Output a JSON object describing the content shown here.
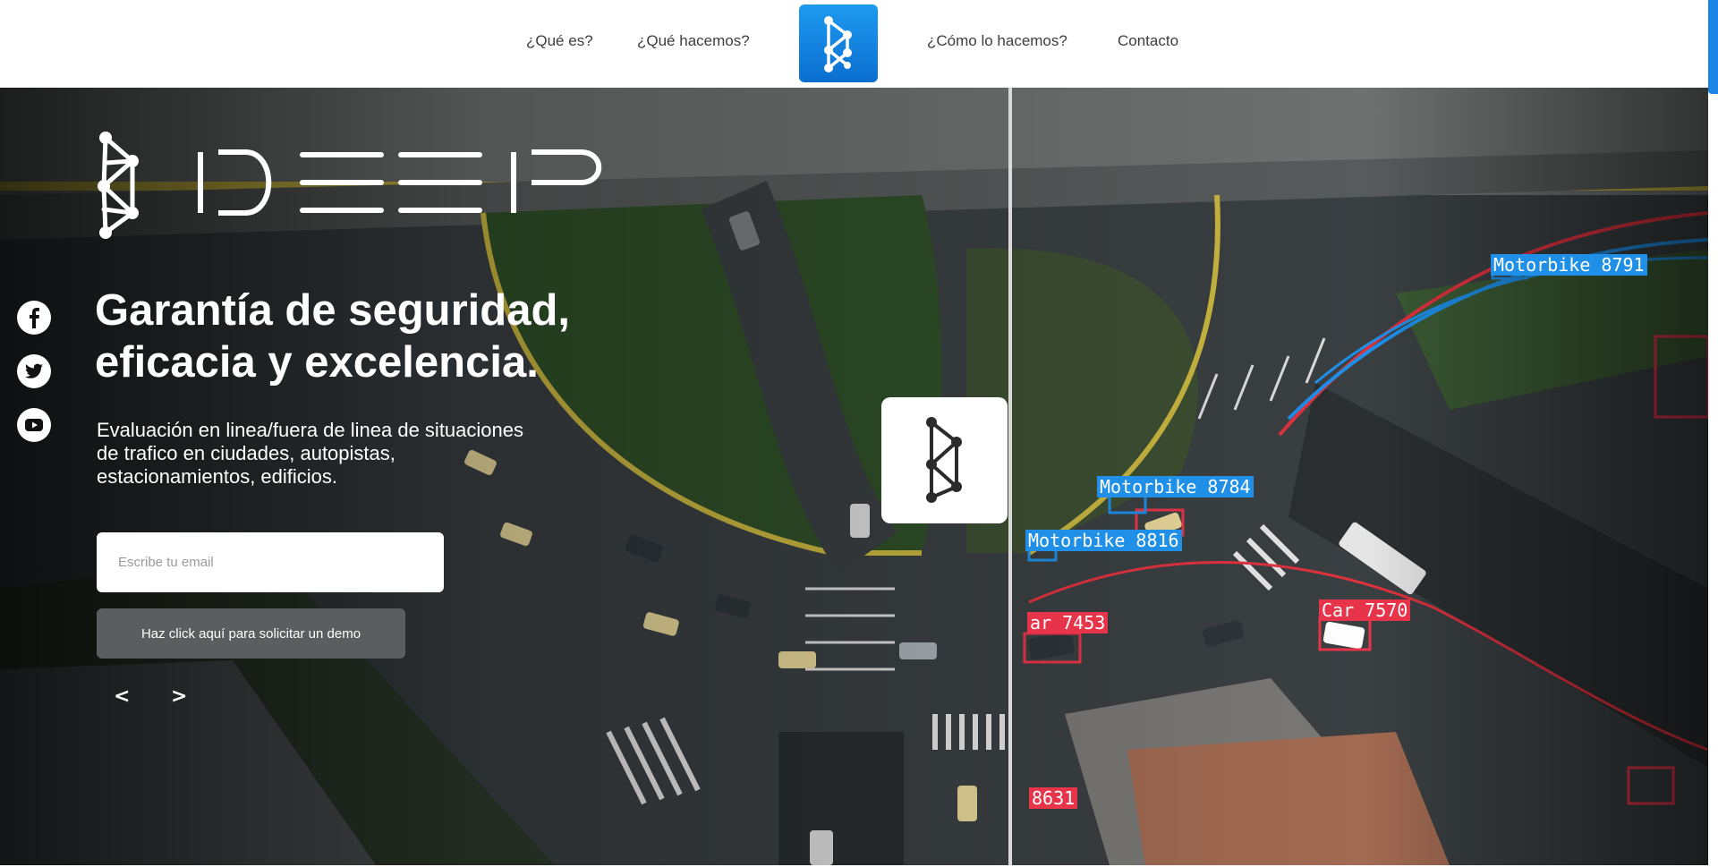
{
  "nav": {
    "links": [
      "¿Qué es?",
      "¿Qué hacemos?",
      "¿Cómo lo hacemos?",
      "Contacto"
    ],
    "logo_icon": "deep-network-icon"
  },
  "hero": {
    "brand": "IDEEP",
    "headline": "Garantía de seguridad,\neficacia y excelencia.",
    "subtext": "Evaluación en linea/fuera de linea de situaciones\nde trafico en ciudades, autopistas,\nestacionamientos, edificios.",
    "email_placeholder": "Escribe tu email",
    "demo_button": "Haz click aquí para solicitar un demo",
    "prev_arrow": "<",
    "next_arrow": ">",
    "social_icons": [
      "facebook-icon",
      "twitter-icon",
      "youtube-icon"
    ],
    "detection_labels": [
      {
        "text": "Motorbike 8784",
        "color": "blue"
      },
      {
        "text": "Motorbike 8816",
        "color": "blue"
      },
      {
        "text": "Motorbike 8791",
        "color": "blue"
      },
      {
        "text": "ar 7453",
        "color": "red"
      },
      {
        "text": "Car 7570",
        "color": "red"
      },
      {
        "text": "8631",
        "color": "red"
      }
    ]
  },
  "colors": {
    "accent": "#1b86e6",
    "detection_blue": "#1f8fe8",
    "detection_red": "#e8344a",
    "button_gray": "#5b5d5e"
  }
}
